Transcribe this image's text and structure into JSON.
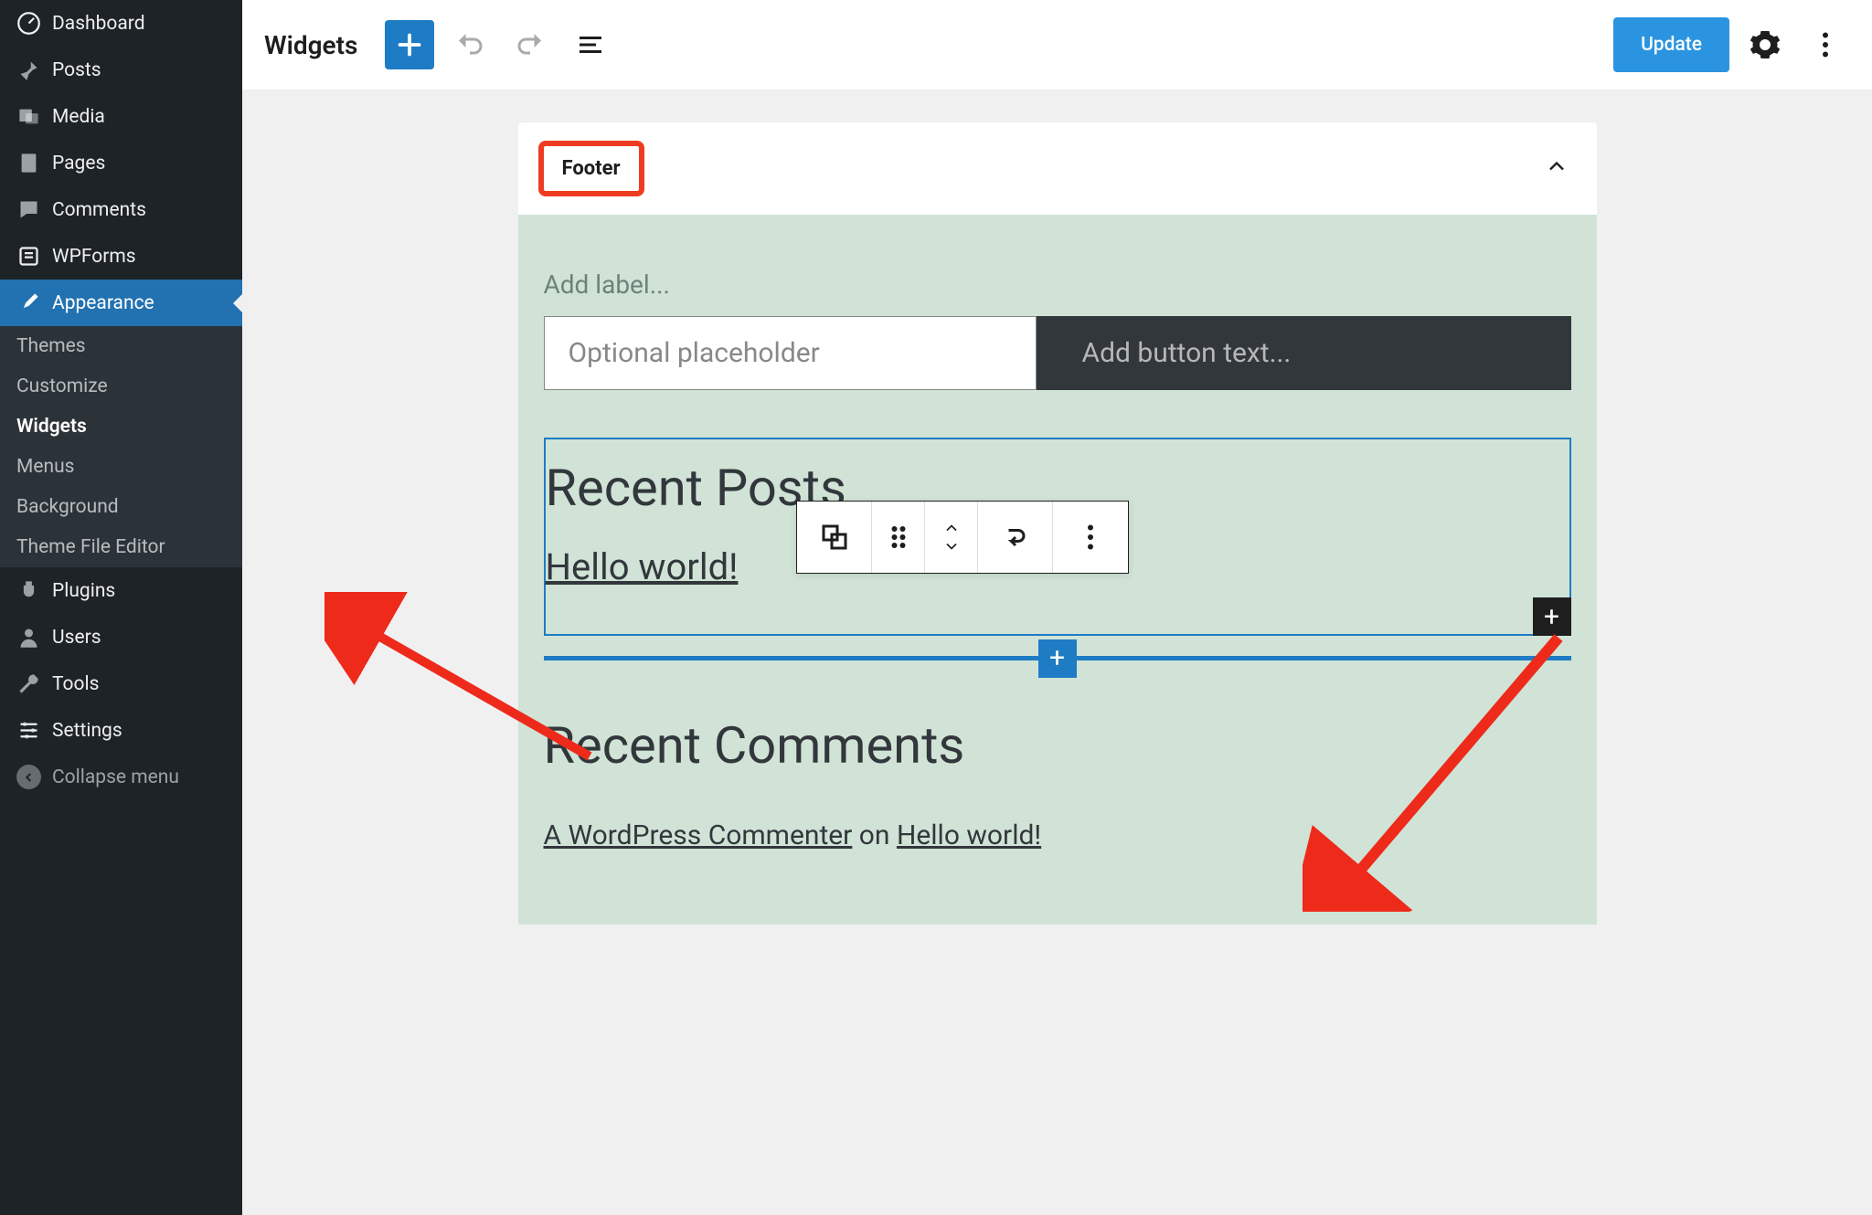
{
  "sidebar": {
    "items": [
      {
        "label": "Dashboard",
        "icon": "dashboard"
      },
      {
        "label": "Posts",
        "icon": "pin"
      },
      {
        "label": "Media",
        "icon": "media"
      },
      {
        "label": "Pages",
        "icon": "page"
      },
      {
        "label": "Comments",
        "icon": "comment"
      },
      {
        "label": "WPForms",
        "icon": "form"
      },
      {
        "label": "Appearance",
        "icon": "brush",
        "active": true
      },
      {
        "label": "Plugins",
        "icon": "plug"
      },
      {
        "label": "Users",
        "icon": "user"
      },
      {
        "label": "Tools",
        "icon": "wrench"
      },
      {
        "label": "Settings",
        "icon": "sliders"
      }
    ],
    "submenu": [
      {
        "label": "Themes"
      },
      {
        "label": "Customize"
      },
      {
        "label": "Widgets",
        "current": true
      },
      {
        "label": "Menus"
      },
      {
        "label": "Background"
      },
      {
        "label": "Theme File Editor"
      }
    ],
    "collapse": "Collapse menu"
  },
  "topbar": {
    "title": "Widgets",
    "update": "Update"
  },
  "panel": {
    "title": "Footer",
    "add_label_placeholder": "Add label...",
    "search_placeholder": "Optional placeholder",
    "button_placeholder": "Add button text...",
    "recent_posts": {
      "heading": "Recent Posts",
      "items": [
        "Hello world!"
      ]
    },
    "recent_comments": {
      "heading": "Recent Comments",
      "items": [
        {
          "author": "A WordPress Commenter",
          "on": "on",
          "post": "Hello world!"
        }
      ]
    }
  }
}
